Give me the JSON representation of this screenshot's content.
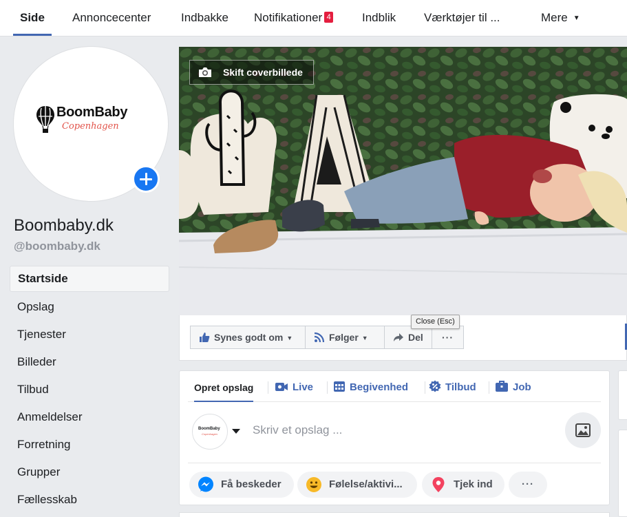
{
  "topnav": {
    "tabs": [
      {
        "label": "Side"
      },
      {
        "label": "Annoncecenter"
      },
      {
        "label": "Indbakke"
      },
      {
        "label": "Notifikationer",
        "badge": "4"
      },
      {
        "label": "Indblik"
      },
      {
        "label": "Værktøjer til ..."
      },
      {
        "label": "Mere"
      }
    ]
  },
  "profile": {
    "logo_name": "BoomBaby",
    "logo_sub": "Copenhagen",
    "page_name": "Boombaby.dk",
    "handle": "@boombaby.dk"
  },
  "leftnav": {
    "items": [
      {
        "label": "Startside"
      },
      {
        "label": "Opslag"
      },
      {
        "label": "Tjenester"
      },
      {
        "label": "Billeder"
      },
      {
        "label": "Tilbud"
      },
      {
        "label": "Anmeldelser"
      },
      {
        "label": "Forretning"
      },
      {
        "label": "Grupper"
      },
      {
        "label": "Fællesskab"
      }
    ]
  },
  "cover": {
    "change_cover_label": "Skift coverbillede"
  },
  "actions": {
    "like": "Synes godt om",
    "follow": "Følger",
    "share": "Del",
    "more": "···",
    "tooltip": "Close (Esc)"
  },
  "composer": {
    "tabs": [
      {
        "label": "Opret opslag"
      },
      {
        "label": "Live"
      },
      {
        "label": "Begivenhed"
      },
      {
        "label": "Tilbud"
      },
      {
        "label": "Job"
      }
    ],
    "placeholder": "Skriv et opslag ...",
    "avatar_name": "BoomBaby",
    "avatar_sub": "Copenhagen",
    "pills": [
      {
        "label": "Få beskeder"
      },
      {
        "label": "Følelse/aktivi..."
      },
      {
        "label": "Tjek ind"
      },
      {
        "label": "···"
      }
    ]
  },
  "colors": {
    "accent": "#4267b2",
    "messenger": "#0084ff",
    "badge": "#e41e3f",
    "add_button": "#1877f2"
  }
}
